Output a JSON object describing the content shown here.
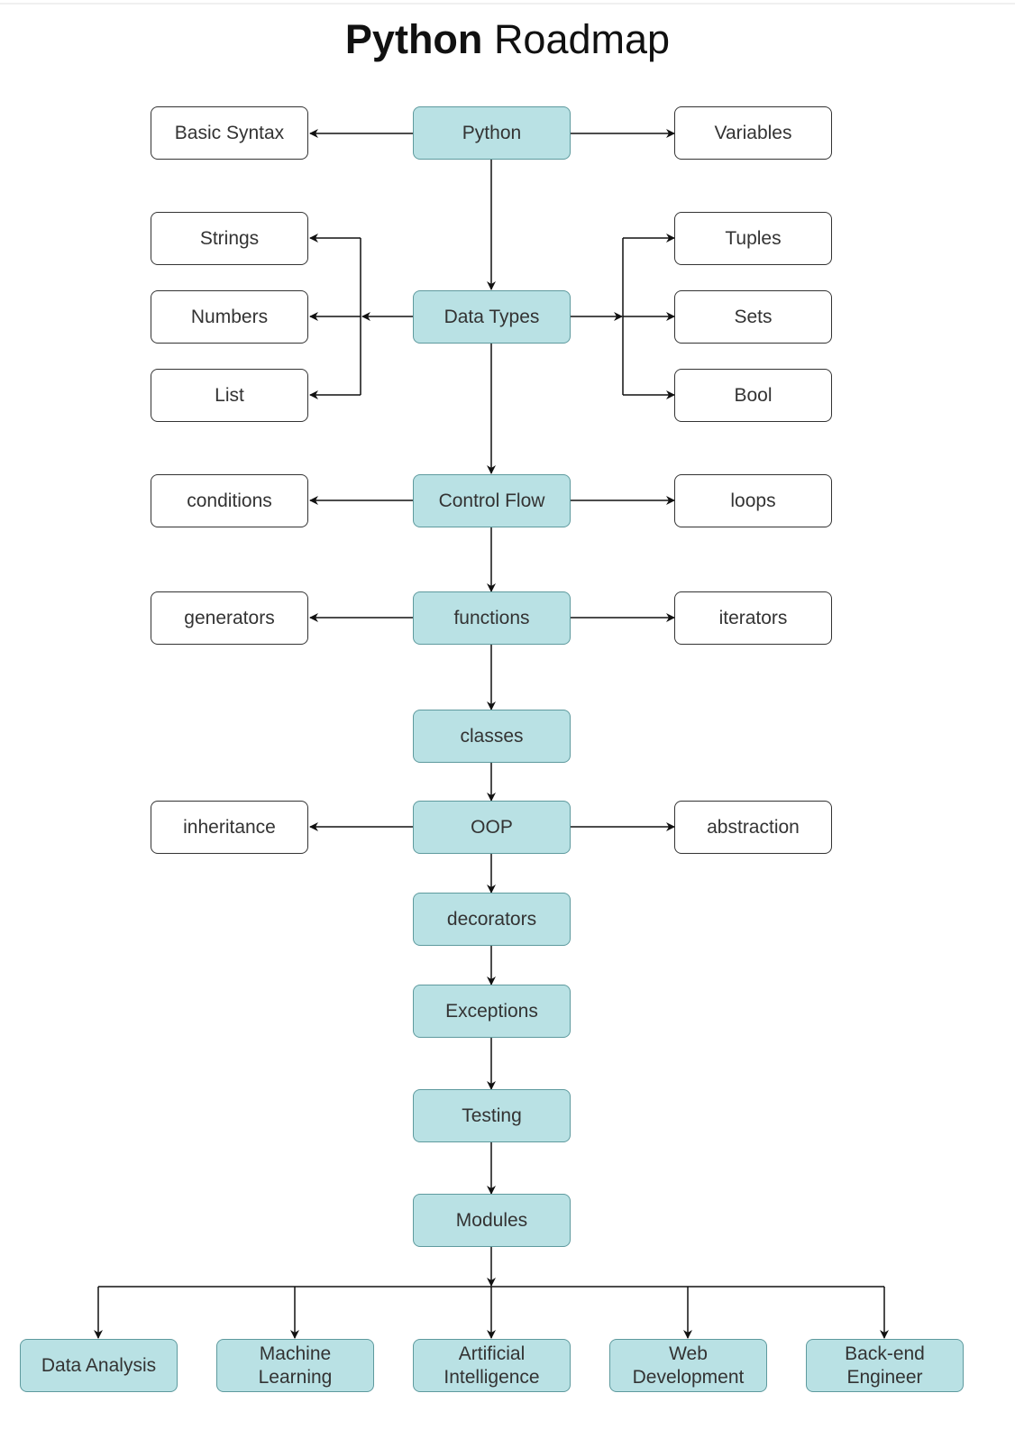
{
  "title": {
    "bold": "Python",
    "regular": "Roadmap"
  },
  "colors": {
    "main_fill": "#b9e1e4",
    "main_border": "#5e9a9e",
    "sub_fill": "#ffffff",
    "sub_border": "#333333",
    "edge": "#111111"
  },
  "nodes": {
    "python": "Python",
    "basic_syntax": "Basic Syntax",
    "variables": "Variables",
    "data_types": "Data Types",
    "strings": "Strings",
    "numbers": "Numbers",
    "list": "List",
    "tuples": "Tuples",
    "sets": "Sets",
    "bool": "Bool",
    "control_flow": "Control Flow",
    "conditions": "conditions",
    "loops": "loops",
    "functions": "functions",
    "generators": "generators",
    "iterators": "iterators",
    "classes": "classes",
    "oop": "OOP",
    "inheritance": "inheritance",
    "abstraction": "abstraction",
    "decorators": "decorators",
    "exceptions": "Exceptions",
    "testing": "Testing",
    "modules": "Modules",
    "data_analysis": "Data Analysis",
    "machine_learning": "Machine\nLearning",
    "artificial_intelligence": "Artificial\nIntelligence",
    "web_development": "Web\nDevelopment",
    "backend_engineer": "Back-end\nEngineer"
  },
  "edges": [
    [
      "python",
      "basic_syntax"
    ],
    [
      "python",
      "variables"
    ],
    [
      "python",
      "data_types"
    ],
    [
      "data_types",
      "strings"
    ],
    [
      "data_types",
      "numbers"
    ],
    [
      "data_types",
      "list"
    ],
    [
      "data_types",
      "tuples"
    ],
    [
      "data_types",
      "sets"
    ],
    [
      "data_types",
      "bool"
    ],
    [
      "data_types",
      "control_flow"
    ],
    [
      "control_flow",
      "conditions"
    ],
    [
      "control_flow",
      "loops"
    ],
    [
      "control_flow",
      "functions"
    ],
    [
      "functions",
      "generators"
    ],
    [
      "functions",
      "iterators"
    ],
    [
      "functions",
      "classes"
    ],
    [
      "classes",
      "oop"
    ],
    [
      "oop",
      "inheritance"
    ],
    [
      "oop",
      "abstraction"
    ],
    [
      "oop",
      "decorators"
    ],
    [
      "decorators",
      "exceptions"
    ],
    [
      "exceptions",
      "testing"
    ],
    [
      "testing",
      "modules"
    ],
    [
      "modules",
      "data_analysis"
    ],
    [
      "modules",
      "machine_learning"
    ],
    [
      "modules",
      "artificial_intelligence"
    ],
    [
      "modules",
      "web_development"
    ],
    [
      "modules",
      "backend_engineer"
    ]
  ]
}
